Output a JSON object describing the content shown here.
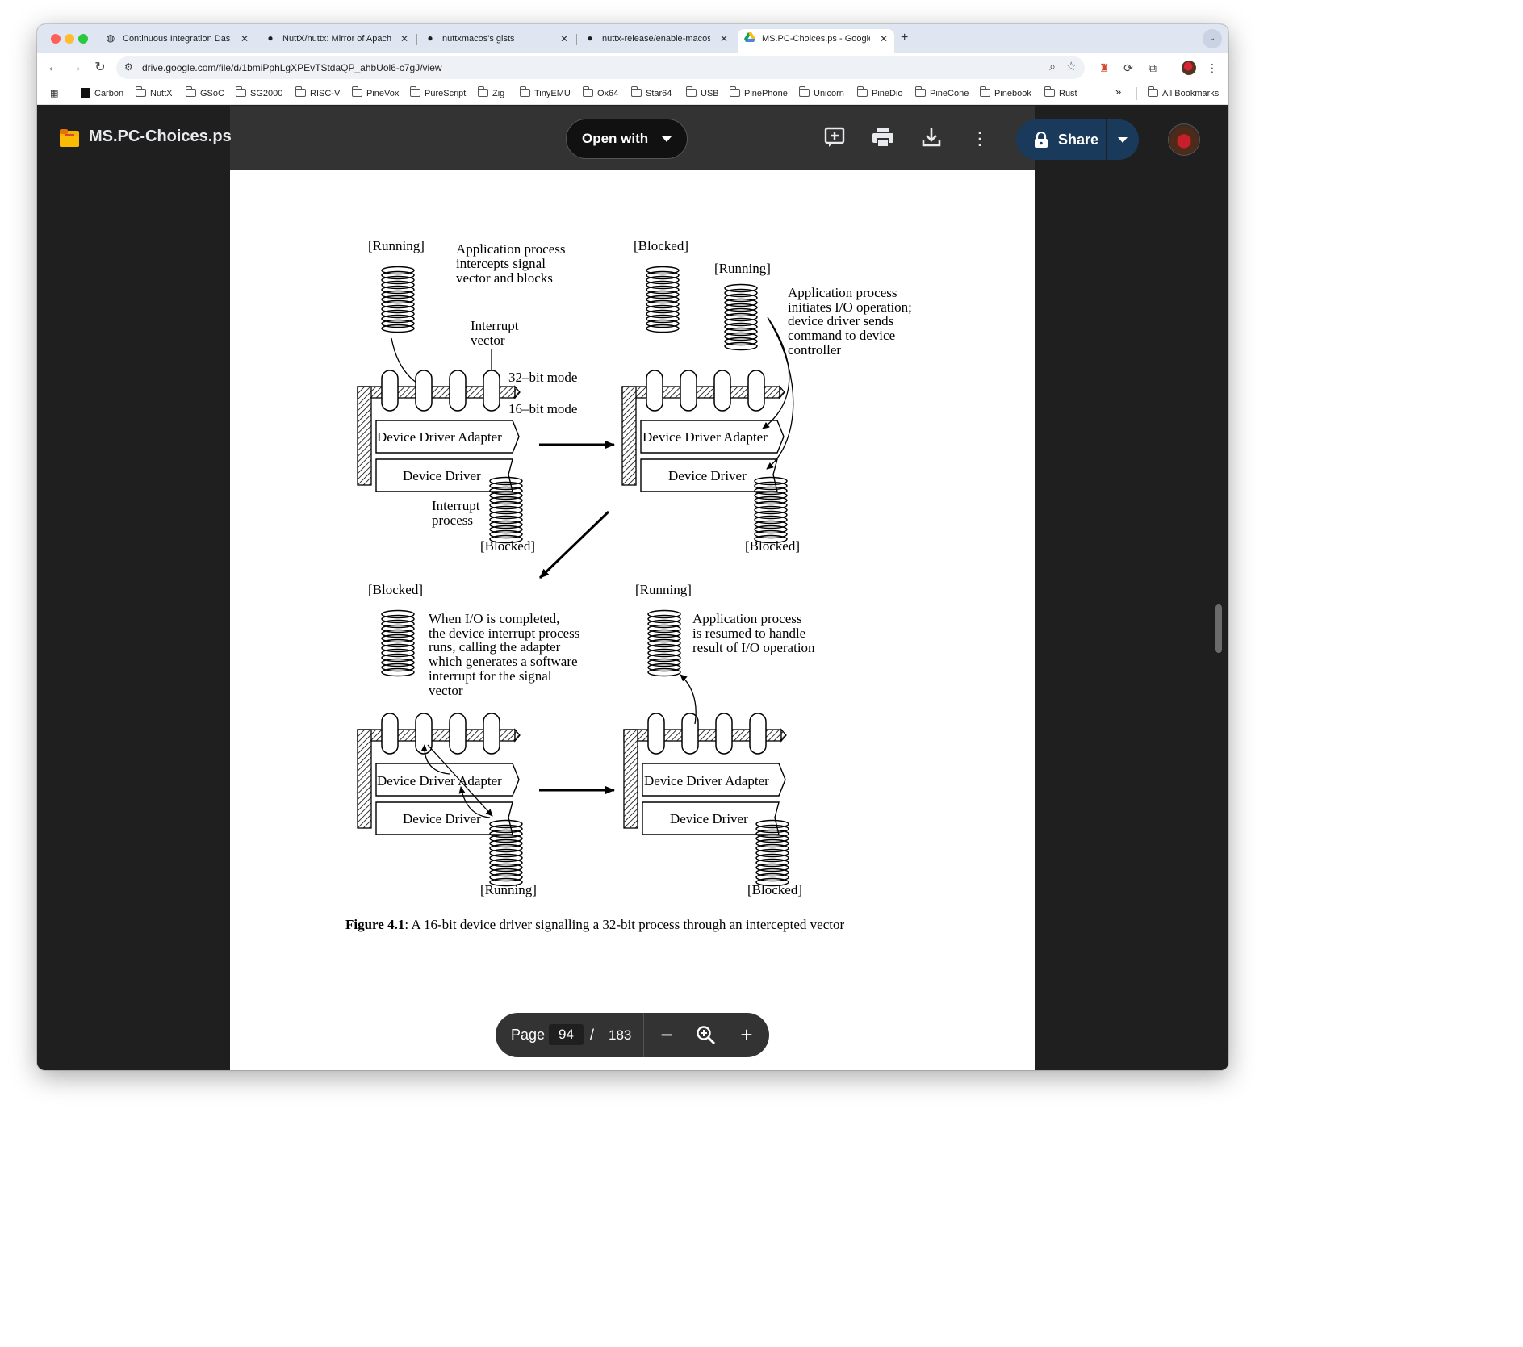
{
  "browser": {
    "tabs": [
      {
        "title": "Continuous Integration Dashb",
        "icon": "globe-icon"
      },
      {
        "title": "NuttX/nuttx: Mirror of Apache",
        "icon": "github-icon"
      },
      {
        "title": "nuttxmacos's gists",
        "icon": "github-icon"
      },
      {
        "title": "nuttx-release/enable-macos-",
        "icon": "github-icon"
      },
      {
        "title": "MS.PC-Choices.ps - Google",
        "icon": "google-drive-icon"
      }
    ],
    "active_tab": 4,
    "url": "drive.google.com/file/d/1bmiPphLgXPEvTStdaQP_ahbUol6-c7gJ/view",
    "bookmarks": [
      "Carbon",
      "NuttX",
      "GSoC",
      "SG2000",
      "RISC-V",
      "PineVox",
      "PureScript",
      "Zig",
      "TinyEMU",
      "Ox64",
      "Star64",
      "USB",
      "PinePhone",
      "Unicorn",
      "PineDio",
      "PineCone",
      "Pinebook",
      "Rust"
    ],
    "bookmarks_overflow": "»",
    "all_bookmarks": "All Bookmarks"
  },
  "viewer": {
    "doc_title": "MS.PC-Choices.ps",
    "open_with": "Open with",
    "share": "Share",
    "page_label": "Page",
    "page_current": "94",
    "page_separator": "/",
    "page_total": "183",
    "accent_color": "#1a3a5c"
  },
  "figure": {
    "p1": {
      "running": "[Running]",
      "note": [
        "Application process",
        "intercepts signal",
        "vector and blocks"
      ],
      "interrupt_vector": [
        "Interrupt",
        "vector"
      ],
      "mode32": "32–bit mode",
      "mode16": "16–bit mode",
      "adapter": "Device Driver Adapter",
      "driver": "Device Driver",
      "interrupt_process": [
        "Interrupt",
        "process"
      ],
      "blocked": "[Blocked]"
    },
    "p2": {
      "blocked_top": "[Blocked]",
      "running": "[Running]",
      "note": [
        "Application process",
        "initiates I/O operation;",
        "device driver sends",
        "command to device",
        "controller"
      ],
      "adapter": "Device Driver Adapter",
      "driver": "Device Driver",
      "blocked_bottom": "[Blocked]"
    },
    "p3": {
      "blocked": "[Blocked]",
      "note": [
        "When I/O is completed,",
        "the device interrupt process",
        "runs, calling the adapter",
        "which generates a software",
        "interrupt for the signal",
        "vector"
      ],
      "adapter": "Device Driver Adapter",
      "driver": "Device Driver",
      "running": "[Running]"
    },
    "p4": {
      "running": "[Running]",
      "note": [
        "Application process",
        "is resumed to handle",
        "result of I/O operation"
      ],
      "adapter": "Device Driver Adapter",
      "driver": "Device Driver",
      "blocked": "[Blocked]"
    },
    "caption_label": "Figure 4.1",
    "caption_text": ": A 16-bit device driver signalling a 32-bit process through an intercepted vector"
  }
}
